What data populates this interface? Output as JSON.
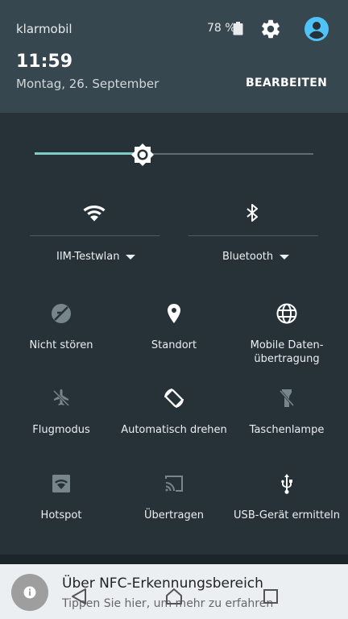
{
  "status_bar": {
    "carrier": "klarmobil",
    "battery": "78 %"
  },
  "header": {
    "time": "11:59",
    "date": "Montag, 26. September",
    "edit_label": "BEARBEITEN"
  },
  "brightness": {
    "level_percent": 39,
    "accent": "#80cbc4"
  },
  "toggles": [
    {
      "label": "IIM-Testwlan",
      "icon": "wifi-icon"
    },
    {
      "label": "Bluetooth",
      "icon": "bluetooth-icon"
    }
  ],
  "tiles": [
    {
      "label": "Nicht stören",
      "icon": "do-not-disturb-icon"
    },
    {
      "label": "Standort",
      "icon": "location-icon"
    },
    {
      "label": "Mobile Daten-",
      "label2": "übertragung",
      "icon": "globe-icon"
    },
    {
      "label": "Flugmodus",
      "icon": "airplane-icon"
    },
    {
      "label": "Automatisch drehen",
      "icon": "rotate-icon"
    },
    {
      "label": "Taschenlampe",
      "icon": "flashlight-icon"
    },
    {
      "label": "Hotspot",
      "icon": "hotspot-icon"
    },
    {
      "label": "Übertragen",
      "icon": "cast-icon"
    },
    {
      "label": "USB-Gerät ermitteln",
      "icon": "usb-icon"
    }
  ],
  "notification": {
    "title": "Über NFC-Erkennungsbereich",
    "subtitle": "Tippen Sie hier, um mehr zu erfahren"
  },
  "colors": {
    "header_bg": "#37474f",
    "panel_bg": "#263238",
    "accent": "#80cbc4"
  }
}
